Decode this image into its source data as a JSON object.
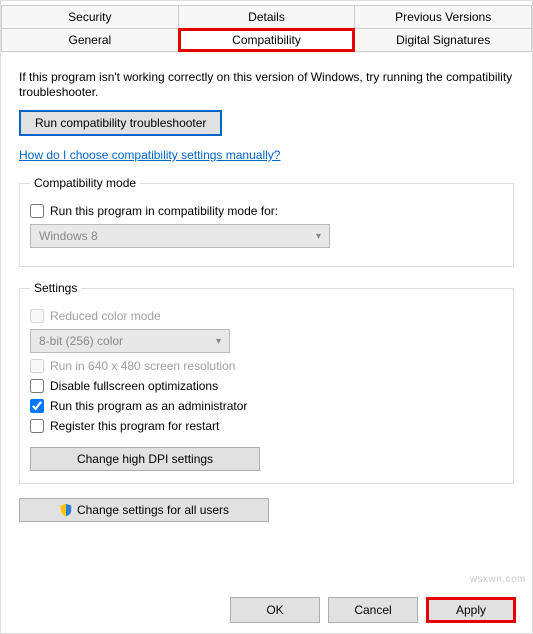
{
  "tabs": {
    "row1": [
      "Security",
      "Details",
      "Previous Versions"
    ],
    "row2": [
      "General",
      "Compatibility",
      "Digital Signatures"
    ],
    "active": "Compatibility"
  },
  "intro": "If this program isn't working correctly on this version of Windows, try running the compatibility troubleshooter.",
  "troubleshooter_button": "Run compatibility troubleshooter",
  "manual_link": "How do I choose compatibility settings manually?",
  "compat_mode": {
    "legend": "Compatibility mode",
    "checkbox_label": "Run this program in compatibility mode for:",
    "checked": false,
    "select_value": "Windows 8"
  },
  "settings": {
    "legend": "Settings",
    "reduced_color": {
      "label": "Reduced color mode",
      "checked": false,
      "enabled": false
    },
    "color_select": "8-bit (256) color",
    "run640": {
      "label": "Run in 640 x 480 screen resolution",
      "checked": false,
      "enabled": false
    },
    "disable_fullscreen": {
      "label": "Disable fullscreen optimizations",
      "checked": false,
      "enabled": true
    },
    "run_admin": {
      "label": "Run this program as an administrator",
      "checked": true,
      "enabled": true
    },
    "register_restart": {
      "label": "Register this program for restart",
      "checked": false,
      "enabled": true
    },
    "dpi_button": "Change high DPI settings"
  },
  "all_users_button": "Change settings for all users",
  "footer": {
    "ok": "OK",
    "cancel": "Cancel",
    "apply": "Apply"
  },
  "watermark": "wsxwn.com"
}
